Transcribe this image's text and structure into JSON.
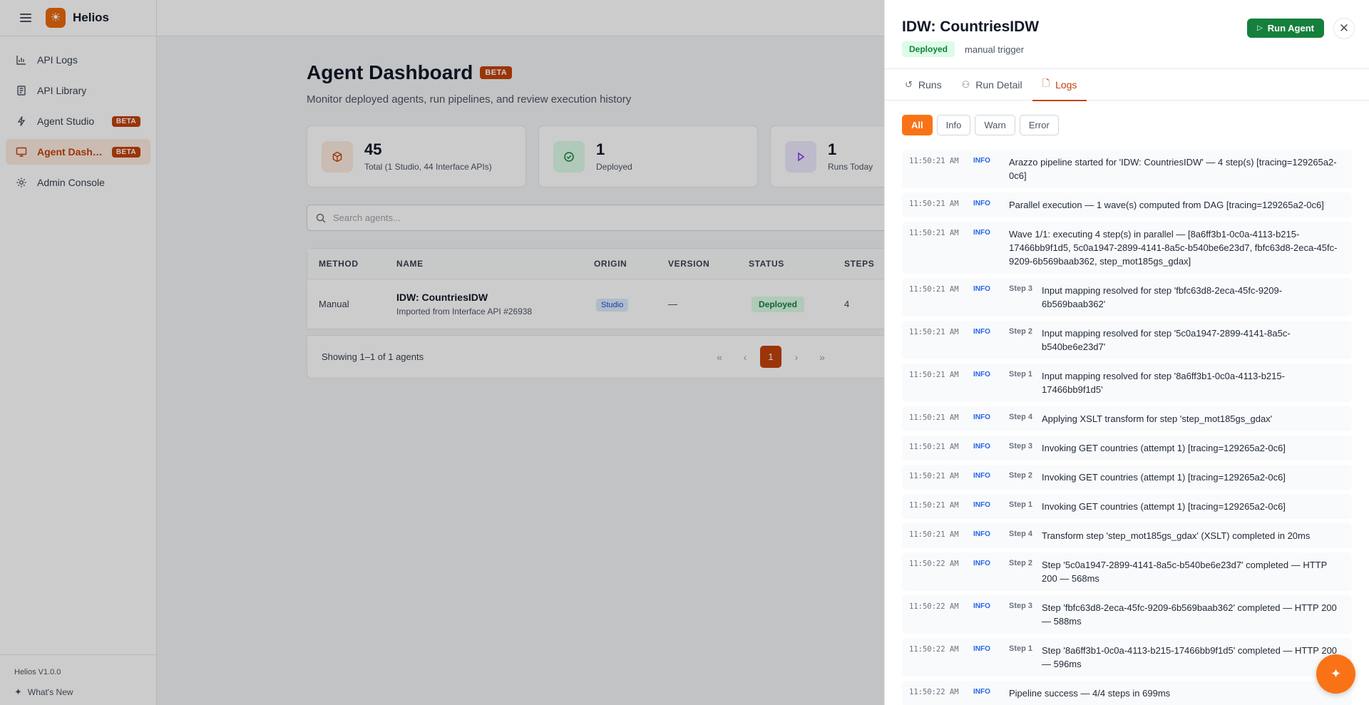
{
  "app": {
    "name": "Helios",
    "version": "Helios V1.0.0",
    "whats_new": "What's New"
  },
  "sidebar": {
    "items": [
      {
        "label": "API Logs",
        "icon": "bar-chart-icon"
      },
      {
        "label": "API Library",
        "icon": "book-icon"
      },
      {
        "label": "Agent Studio",
        "icon": "bolt-icon",
        "badge": "BETA"
      },
      {
        "label": "Agent Dashboard",
        "icon": "monitor-icon",
        "badge": "BETA",
        "active": true
      },
      {
        "label": "Admin Console",
        "icon": "gear-icon"
      }
    ]
  },
  "dashboard": {
    "title": "Agent Dashboard",
    "title_badge": "BETA",
    "subtitle": "Monitor deployed agents, run pipelines, and review execution history",
    "stats": [
      {
        "value": "45",
        "label": "Total (1 Studio, 44 Interface APIs)",
        "icon": "cube-icon"
      },
      {
        "value": "1",
        "label": "Deployed",
        "icon": "check-circle-icon"
      },
      {
        "value": "1",
        "label": "Runs Today",
        "icon": "play-icon"
      }
    ],
    "search_placeholder": "Search agents...",
    "table": {
      "headers": [
        "METHOD",
        "NAME",
        "ORIGIN",
        "VERSION",
        "STATUS",
        "STEPS"
      ],
      "rows": [
        {
          "method": "Manual",
          "name": "IDW: CountriesIDW",
          "subtitle": "Imported from Interface API #26938",
          "origin": "Studio",
          "version": "—",
          "status": "Deployed",
          "steps": "4"
        }
      ]
    },
    "pagination": {
      "summary": "Showing 1–1 of 1 agents",
      "current_page": "1"
    }
  },
  "drawer": {
    "title": "IDW: CountriesIDW",
    "status": "Deployed",
    "trigger": "manual trigger",
    "run_button": "Run Agent",
    "tabs": [
      "Runs",
      "Run Detail",
      "Logs"
    ],
    "active_tab": "Logs",
    "filters": [
      "All",
      "Info",
      "Warn",
      "Error"
    ],
    "active_filter": "All",
    "logs": [
      {
        "time": "11:50:21 AM",
        "level": "INFO",
        "step": "",
        "message": "Arazzo pipeline started for 'IDW: CountriesIDW' — 4 step(s) [tracing=129265a2-0c6]"
      },
      {
        "time": "11:50:21 AM",
        "level": "INFO",
        "step": "",
        "message": "Parallel execution — 1 wave(s) computed from DAG [tracing=129265a2-0c6]"
      },
      {
        "time": "11:50:21 AM",
        "level": "INFO",
        "step": "",
        "message": "Wave 1/1: executing 4 step(s) in parallel — [8a6ff3b1-0c0a-4113-b215-17466bb9f1d5, 5c0a1947-2899-4141-8a5c-b540be6e23d7, fbfc63d8-2eca-45fc-9209-6b569baab362, step_mot185gs_gdax]"
      },
      {
        "time": "11:50:21 AM",
        "level": "INFO",
        "step": "Step 3",
        "message": "Input mapping resolved for step 'fbfc63d8-2eca-45fc-9209-6b569baab362'"
      },
      {
        "time": "11:50:21 AM",
        "level": "INFO",
        "step": "Step 2",
        "message": "Input mapping resolved for step '5c0a1947-2899-4141-8a5c-b540be6e23d7'"
      },
      {
        "time": "11:50:21 AM",
        "level": "INFO",
        "step": "Step 1",
        "message": "Input mapping resolved for step '8a6ff3b1-0c0a-4113-b215-17466bb9f1d5'"
      },
      {
        "time": "11:50:21 AM",
        "level": "INFO",
        "step": "Step 4",
        "message": "Applying XSLT transform for step 'step_mot185gs_gdax'"
      },
      {
        "time": "11:50:21 AM",
        "level": "INFO",
        "step": "Step 3",
        "message": "Invoking GET countries (attempt 1) [tracing=129265a2-0c6]"
      },
      {
        "time": "11:50:21 AM",
        "level": "INFO",
        "step": "Step 2",
        "message": "Invoking GET countries (attempt 1) [tracing=129265a2-0c6]"
      },
      {
        "time": "11:50:21 AM",
        "level": "INFO",
        "step": "Step 1",
        "message": "Invoking GET countries (attempt 1) [tracing=129265a2-0c6]"
      },
      {
        "time": "11:50:21 AM",
        "level": "INFO",
        "step": "Step 4",
        "message": "Transform step 'step_mot185gs_gdax' (XSLT) completed in 20ms"
      },
      {
        "time": "11:50:22 AM",
        "level": "INFO",
        "step": "Step 2",
        "message": "Step '5c0a1947-2899-4141-8a5c-b540be6e23d7' completed — HTTP 200 — 568ms"
      },
      {
        "time": "11:50:22 AM",
        "level": "INFO",
        "step": "Step 3",
        "message": "Step 'fbfc63d8-2eca-45fc-9209-6b569baab362' completed — HTTP 200 — 588ms"
      },
      {
        "time": "11:50:22 AM",
        "level": "INFO",
        "step": "Step 1",
        "message": "Step '8a6ff3b1-0c0a-4113-b215-17466bb9f1d5' completed — HTTP 200 — 596ms"
      },
      {
        "time": "11:50:22 AM",
        "level": "INFO",
        "step": "",
        "message": "Pipeline success — 4/4 steps in 699ms"
      }
    ]
  },
  "colors": {
    "accent": "#c2410c",
    "accent_light": "#f97316",
    "success": "#15803d",
    "info": "#2563eb"
  }
}
